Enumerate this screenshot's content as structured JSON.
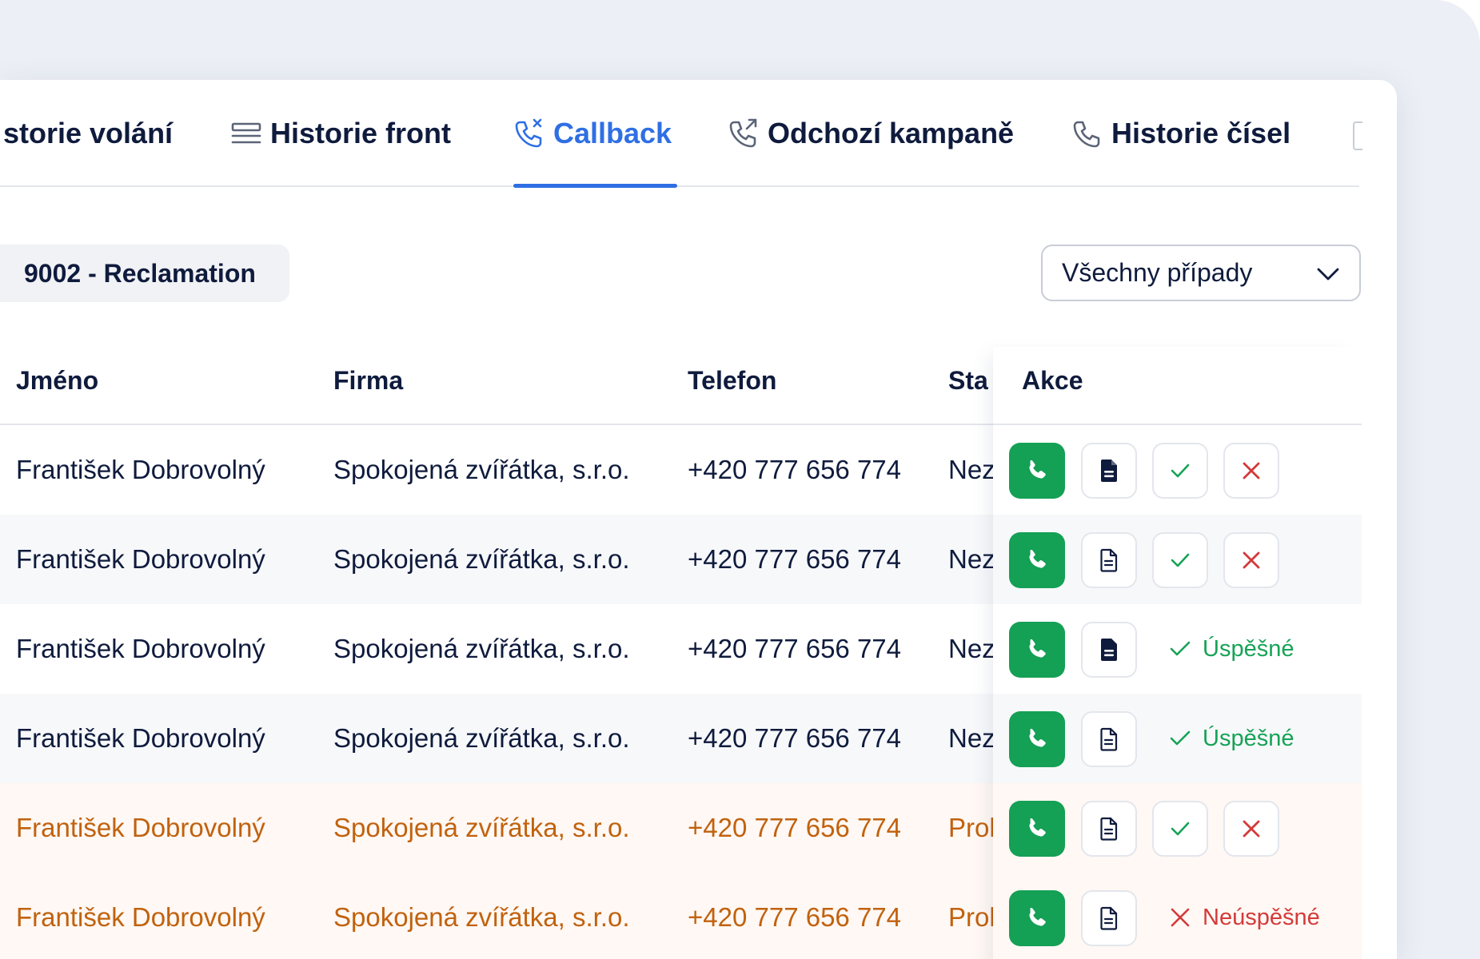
{
  "tabs": [
    {
      "label": "storie volání",
      "icon": "phone-history-icon",
      "active": false
    },
    {
      "label": "Historie front",
      "icon": "list-lines-icon",
      "active": false
    },
    {
      "label": "Callback",
      "icon": "phone-missed-icon",
      "active": true
    },
    {
      "label": "Odchozí kampaně",
      "icon": "phone-outgoing-icon",
      "active": false
    },
    {
      "label": "Historie čísel",
      "icon": "phone-icon",
      "active": false
    }
  ],
  "queue_label": "9002 - Reclamation",
  "filter": {
    "selected": "Všechny případy"
  },
  "table": {
    "headers": {
      "name": "Jméno",
      "company": "Firma",
      "phone": "Telefon",
      "status": "Sta",
      "actions": "Akce"
    },
    "rows": [
      {
        "name": "František Dobrovolný",
        "company": "Spokojená zvířátka, s.r.o.",
        "phone": "+420 777 656 774",
        "status": "Nez",
        "tone": "normal",
        "note_icon": "note-filled-icon",
        "result": null
      },
      {
        "name": "František Dobrovolný",
        "company": "Spokojená zvířátka, s.r.o.",
        "phone": "+420 777 656 774",
        "status": "Nez",
        "tone": "alt",
        "note_icon": "note-outline-icon",
        "result": null
      },
      {
        "name": "František Dobrovolný",
        "company": "Spokojená zvířátka, s.r.o.",
        "phone": "+420 777 656 774",
        "status": "Nez",
        "tone": "normal",
        "note_icon": "note-filled-icon",
        "result": "Úspěšné"
      },
      {
        "name": "František Dobrovolný",
        "company": "Spokojená zvířátka, s.r.o.",
        "phone": "+420 777 656 774",
        "status": "Nez",
        "tone": "alt",
        "note_icon": "note-outline-icon",
        "result": "Úspěšné"
      },
      {
        "name": "František Dobrovolný",
        "company": "Spokojená zvířátka, s.r.o.",
        "phone": "+420 777 656 774",
        "status": "Prol",
        "tone": "warn",
        "note_icon": "note-outline-icon",
        "result": null
      },
      {
        "name": "František Dobrovolný",
        "company": "Spokojená zvířátka, s.r.o.",
        "phone": "+420 777 656 774",
        "status": "Prol",
        "tone": "warn",
        "note_icon": "note-outline-icon",
        "result": "Neúspěšné"
      }
    ]
  },
  "colors": {
    "accent": "#2f6fe4",
    "call_button": "#14a055",
    "success": "#16a356",
    "fail": "#d33a3a",
    "warning_text": "#c1620e"
  }
}
